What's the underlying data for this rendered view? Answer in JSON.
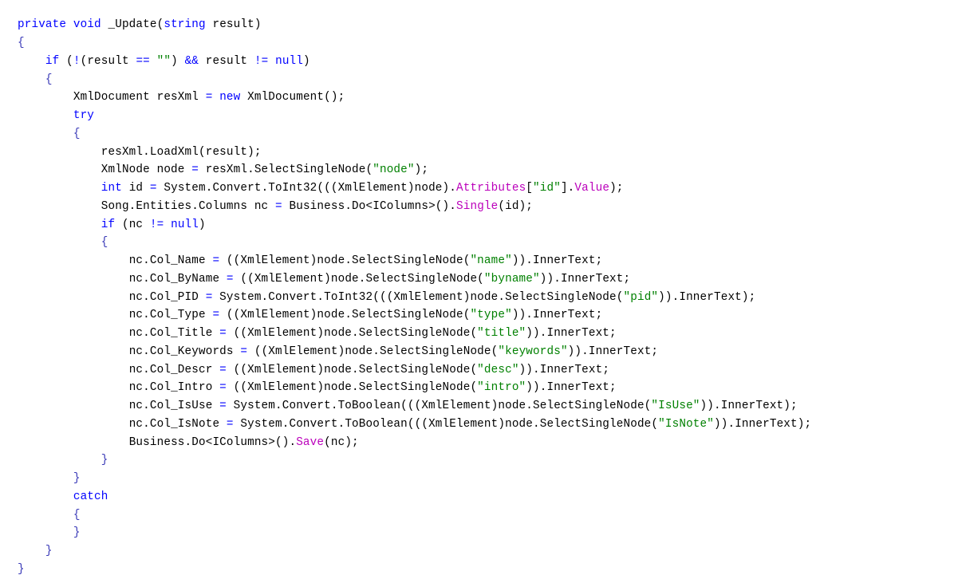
{
  "editor": {
    "language": "C#",
    "background_color": "#ffffff",
    "font_size_px": 14,
    "line_height_px": 22.75
  },
  "syntax_colors": {
    "keyword": "#0000ff",
    "operator": "#0000ff",
    "brace": "#3b3bb8",
    "string": "#008000",
    "property": "#bb00bb",
    "plain": "#000000"
  },
  "code": {
    "lines": [
      {
        "indent": 0,
        "tokens": [
          {
            "t": "private",
            "c": "kw"
          },
          {
            "t": " ",
            "c": "plain"
          },
          {
            "t": "void",
            "c": "kw"
          },
          {
            "t": " _Update(",
            "c": "plain"
          },
          {
            "t": "string",
            "c": "kw"
          },
          {
            "t": " result)",
            "c": "plain"
          }
        ]
      },
      {
        "indent": 0,
        "tokens": [
          {
            "t": "{",
            "c": "brace"
          }
        ]
      },
      {
        "indent": 1,
        "tokens": [
          {
            "t": "if",
            "c": "kw"
          },
          {
            "t": " (",
            "c": "plain"
          },
          {
            "t": "!",
            "c": "op"
          },
          {
            "t": "(result ",
            "c": "plain"
          },
          {
            "t": "==",
            "c": "op"
          },
          {
            "t": " ",
            "c": "plain"
          },
          {
            "t": "\"\"",
            "c": "str"
          },
          {
            "t": ") ",
            "c": "plain"
          },
          {
            "t": "&&",
            "c": "op"
          },
          {
            "t": " result ",
            "c": "plain"
          },
          {
            "t": "!=",
            "c": "op"
          },
          {
            "t": " ",
            "c": "plain"
          },
          {
            "t": "null",
            "c": "kw"
          },
          {
            "t": ")",
            "c": "plain"
          }
        ]
      },
      {
        "indent": 1,
        "tokens": [
          {
            "t": "{",
            "c": "brace"
          }
        ]
      },
      {
        "indent": 2,
        "tokens": [
          {
            "t": "XmlDocument resXml ",
            "c": "plain"
          },
          {
            "t": "=",
            "c": "op"
          },
          {
            "t": " ",
            "c": "plain"
          },
          {
            "t": "new",
            "c": "kw"
          },
          {
            "t": " XmlDocument();",
            "c": "plain"
          }
        ]
      },
      {
        "indent": 2,
        "tokens": [
          {
            "t": "try",
            "c": "kw"
          }
        ]
      },
      {
        "indent": 2,
        "tokens": [
          {
            "t": "{",
            "c": "brace"
          }
        ]
      },
      {
        "indent": 3,
        "tokens": [
          {
            "t": "resXml.LoadXml(result);",
            "c": "plain"
          }
        ]
      },
      {
        "indent": 3,
        "tokens": [
          {
            "t": "XmlNode node ",
            "c": "plain"
          },
          {
            "t": "=",
            "c": "op"
          },
          {
            "t": " resXml.SelectSingleNode(",
            "c": "plain"
          },
          {
            "t": "\"node\"",
            "c": "str"
          },
          {
            "t": ");",
            "c": "plain"
          }
        ]
      },
      {
        "indent": 3,
        "tokens": [
          {
            "t": "int",
            "c": "kw"
          },
          {
            "t": " id ",
            "c": "plain"
          },
          {
            "t": "=",
            "c": "op"
          },
          {
            "t": " System.Convert.ToInt32(((XmlElement)node).",
            "c": "plain"
          },
          {
            "t": "Attributes",
            "c": "prop"
          },
          {
            "t": "[",
            "c": "plain"
          },
          {
            "t": "\"id\"",
            "c": "str"
          },
          {
            "t": "].",
            "c": "plain"
          },
          {
            "t": "Value",
            "c": "prop"
          },
          {
            "t": ");",
            "c": "plain"
          }
        ]
      },
      {
        "indent": 3,
        "tokens": [
          {
            "t": "Song.Entities.Columns nc ",
            "c": "plain"
          },
          {
            "t": "=",
            "c": "op"
          },
          {
            "t": " Business.Do<IColumns>().",
            "c": "plain"
          },
          {
            "t": "Single",
            "c": "prop"
          },
          {
            "t": "(id);",
            "c": "plain"
          }
        ]
      },
      {
        "indent": 3,
        "tokens": [
          {
            "t": "if",
            "c": "kw"
          },
          {
            "t": " (nc ",
            "c": "plain"
          },
          {
            "t": "!=",
            "c": "op"
          },
          {
            "t": " ",
            "c": "plain"
          },
          {
            "t": "null",
            "c": "kw"
          },
          {
            "t": ")",
            "c": "plain"
          }
        ]
      },
      {
        "indent": 3,
        "tokens": [
          {
            "t": "{",
            "c": "brace"
          }
        ]
      },
      {
        "indent": 4,
        "tokens": [
          {
            "t": "nc.Col_Name ",
            "c": "plain"
          },
          {
            "t": "=",
            "c": "op"
          },
          {
            "t": " ((XmlElement)node.SelectSingleNode(",
            "c": "plain"
          },
          {
            "t": "\"name\"",
            "c": "str"
          },
          {
            "t": ")).InnerText;",
            "c": "plain"
          }
        ]
      },
      {
        "indent": 4,
        "tokens": [
          {
            "t": "nc.Col_ByName ",
            "c": "plain"
          },
          {
            "t": "=",
            "c": "op"
          },
          {
            "t": " ((XmlElement)node.SelectSingleNode(",
            "c": "plain"
          },
          {
            "t": "\"byname\"",
            "c": "str"
          },
          {
            "t": ")).InnerText;",
            "c": "plain"
          }
        ]
      },
      {
        "indent": 4,
        "tokens": [
          {
            "t": "nc.Col_PID ",
            "c": "plain"
          },
          {
            "t": "=",
            "c": "op"
          },
          {
            "t": " System.Convert.ToInt32(((XmlElement)node.SelectSingleNode(",
            "c": "plain"
          },
          {
            "t": "\"pid\"",
            "c": "str"
          },
          {
            "t": ")).InnerText);",
            "c": "plain"
          }
        ]
      },
      {
        "indent": 4,
        "tokens": [
          {
            "t": "nc.Col_Type ",
            "c": "plain"
          },
          {
            "t": "=",
            "c": "op"
          },
          {
            "t": " ((XmlElement)node.SelectSingleNode(",
            "c": "plain"
          },
          {
            "t": "\"type\"",
            "c": "str"
          },
          {
            "t": ")).InnerText;",
            "c": "plain"
          }
        ]
      },
      {
        "indent": 4,
        "tokens": [
          {
            "t": "nc.Col_Title ",
            "c": "plain"
          },
          {
            "t": "=",
            "c": "op"
          },
          {
            "t": " ((XmlElement)node.SelectSingleNode(",
            "c": "plain"
          },
          {
            "t": "\"title\"",
            "c": "str"
          },
          {
            "t": ")).InnerText;",
            "c": "plain"
          }
        ]
      },
      {
        "indent": 4,
        "tokens": [
          {
            "t": "nc.Col_Keywords ",
            "c": "plain"
          },
          {
            "t": "=",
            "c": "op"
          },
          {
            "t": " ((XmlElement)node.SelectSingleNode(",
            "c": "plain"
          },
          {
            "t": "\"keywords\"",
            "c": "str"
          },
          {
            "t": ")).InnerText;",
            "c": "plain"
          }
        ]
      },
      {
        "indent": 4,
        "tokens": [
          {
            "t": "nc.Col_Descr ",
            "c": "plain"
          },
          {
            "t": "=",
            "c": "op"
          },
          {
            "t": " ((XmlElement)node.SelectSingleNode(",
            "c": "plain"
          },
          {
            "t": "\"desc\"",
            "c": "str"
          },
          {
            "t": ")).InnerText;",
            "c": "plain"
          }
        ]
      },
      {
        "indent": 4,
        "tokens": [
          {
            "t": "nc.Col_Intro ",
            "c": "plain"
          },
          {
            "t": "=",
            "c": "op"
          },
          {
            "t": " ((XmlElement)node.SelectSingleNode(",
            "c": "plain"
          },
          {
            "t": "\"intro\"",
            "c": "str"
          },
          {
            "t": ")).InnerText;",
            "c": "plain"
          }
        ]
      },
      {
        "indent": 4,
        "tokens": [
          {
            "t": "nc.Col_IsUse ",
            "c": "plain"
          },
          {
            "t": "=",
            "c": "op"
          },
          {
            "t": " System.Convert.ToBoolean(((XmlElement)node.SelectSingleNode(",
            "c": "plain"
          },
          {
            "t": "\"IsUse\"",
            "c": "str"
          },
          {
            "t": ")).InnerText);",
            "c": "plain"
          }
        ]
      },
      {
        "indent": 4,
        "tokens": [
          {
            "t": "nc.Col_IsNote ",
            "c": "plain"
          },
          {
            "t": "=",
            "c": "op"
          },
          {
            "t": " System.Convert.ToBoolean(((XmlElement)node.SelectSingleNode(",
            "c": "plain"
          },
          {
            "t": "\"IsNote\"",
            "c": "str"
          },
          {
            "t": ")).InnerText);",
            "c": "plain"
          }
        ]
      },
      {
        "indent": 4,
        "tokens": [
          {
            "t": "Business.Do<IColumns>().",
            "c": "plain"
          },
          {
            "t": "Save",
            "c": "prop"
          },
          {
            "t": "(nc);",
            "c": "plain"
          }
        ]
      },
      {
        "indent": 3,
        "tokens": [
          {
            "t": "}",
            "c": "brace"
          }
        ]
      },
      {
        "indent": 2,
        "tokens": [
          {
            "t": "}",
            "c": "brace"
          }
        ]
      },
      {
        "indent": 2,
        "tokens": [
          {
            "t": "catch",
            "c": "kw"
          }
        ]
      },
      {
        "indent": 2,
        "tokens": [
          {
            "t": "{",
            "c": "brace"
          }
        ]
      },
      {
        "indent": 2,
        "tokens": [
          {
            "t": "}",
            "c": "brace"
          }
        ]
      },
      {
        "indent": 1,
        "tokens": [
          {
            "t": "}",
            "c": "brace"
          }
        ]
      },
      {
        "indent": 0,
        "tokens": [
          {
            "t": "}",
            "c": "brace"
          }
        ]
      }
    ]
  }
}
